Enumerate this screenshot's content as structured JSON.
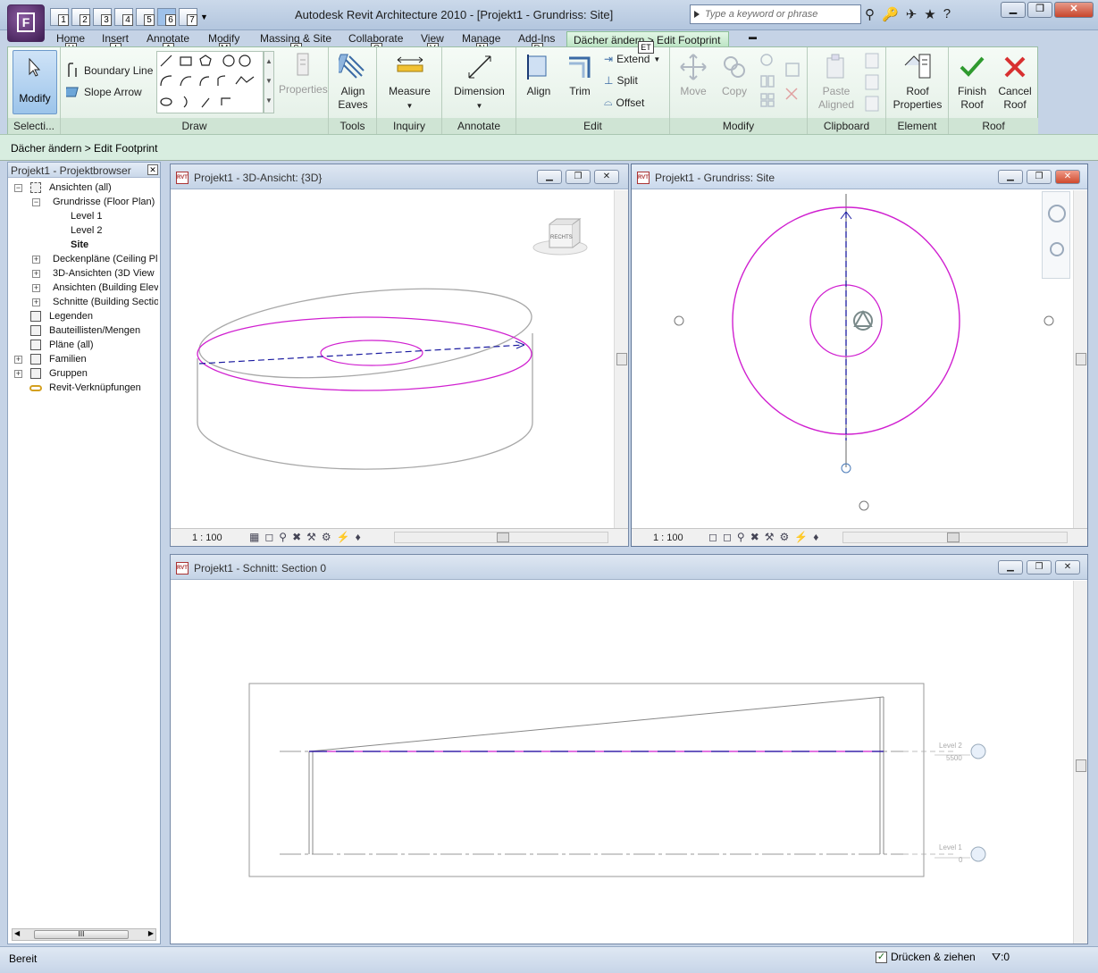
{
  "title_bar": {
    "title": "Autodesk Revit Architecture 2010 - [Projekt1 - Grundriss: Site]",
    "search_placeholder": "Type a keyword or phrase",
    "app_button_key": "F",
    "qat_keys": [
      "1",
      "2",
      "3",
      "4",
      "5",
      "6",
      "7"
    ]
  },
  "ribbon_tabs": [
    {
      "label": "Home",
      "key": "H"
    },
    {
      "label": "Insert",
      "key": "I"
    },
    {
      "label": "Annotate",
      "key": "A"
    },
    {
      "label": "Modify",
      "key": "M"
    },
    {
      "label": "Massing & Site",
      "key": "S"
    },
    {
      "label": "Collaborate",
      "key": "C"
    },
    {
      "label": "View",
      "key": "V"
    },
    {
      "label": "Manage",
      "key": "N"
    },
    {
      "label": "Add-Ins",
      "key": "D"
    }
  ],
  "context_tab": {
    "label": "Dächer ändern > Edit Footprint",
    "key": "ET"
  },
  "ribbon": {
    "modify": "Modify",
    "selection_panel": "Selecti...",
    "boundary_line": "Boundary Line",
    "slope_arrow": "Slope Arrow",
    "properties": "Properties",
    "draw_panel": "Draw",
    "align_eaves_1": "Align",
    "align_eaves_2": "Eaves",
    "tools_panel": "Tools",
    "measure": "Measure",
    "inquiry_panel": "Inquiry",
    "dimension": "Dimension",
    "annotate_panel": "Annotate",
    "align": "Align",
    "trim": "Trim",
    "extend": "Extend",
    "split": "Split",
    "offset": "Offset",
    "edit_panel": "Edit",
    "move": "Move",
    "copy": "Copy",
    "modify_panel": "Modify",
    "paste_1": "Paste",
    "paste_2": "Aligned",
    "clipboard_panel": "Clipboard",
    "roof_props_1": "Roof",
    "roof_props_2": "Properties",
    "element_panel": "Element",
    "finish_1": "Finish",
    "finish_2": "Roof",
    "cancel_1": "Cancel",
    "cancel_2": "Roof",
    "roof_panel": "Roof"
  },
  "options_bar": "Dächer ändern > Edit Footprint",
  "browser": {
    "title": "Projekt1 - Projektbrowser",
    "items": [
      "Ansichten (all)",
      "Grundrisse (Floor Plan)",
      "Level 1",
      "Level 2",
      "Site",
      "Deckenpläne (Ceiling Pl",
      "3D-Ansichten (3D View",
      "Ansichten (Building Elev",
      "Schnitte (Building Sectio",
      "Legenden",
      "Bauteillisten/Mengen",
      "Pläne (all)",
      "Familien",
      "Gruppen",
      "Revit-Verknüpfungen"
    ]
  },
  "views": {
    "v3d": {
      "title": "Projekt1 - 3D-Ansicht: {3D}",
      "scale": "1 : 100",
      "cube_label": "RECHTS"
    },
    "plan": {
      "title": "Projekt1 - Grundriss: Site",
      "scale": "1 : 100"
    },
    "section": {
      "title": "Projekt1 - Schnitt: Section 0",
      "level2": "Level 2",
      "level2_val": "5500",
      "level1": "Level 1",
      "level1_val": "0"
    }
  },
  "status": {
    "text": "Bereit",
    "press_drag": "Drücken & ziehen",
    "filter": ":0"
  },
  "colors": {
    "sketch": "#d020d0",
    "slope": "#1a1aa0",
    "ribbon_ctx": "#cfe4d4"
  }
}
